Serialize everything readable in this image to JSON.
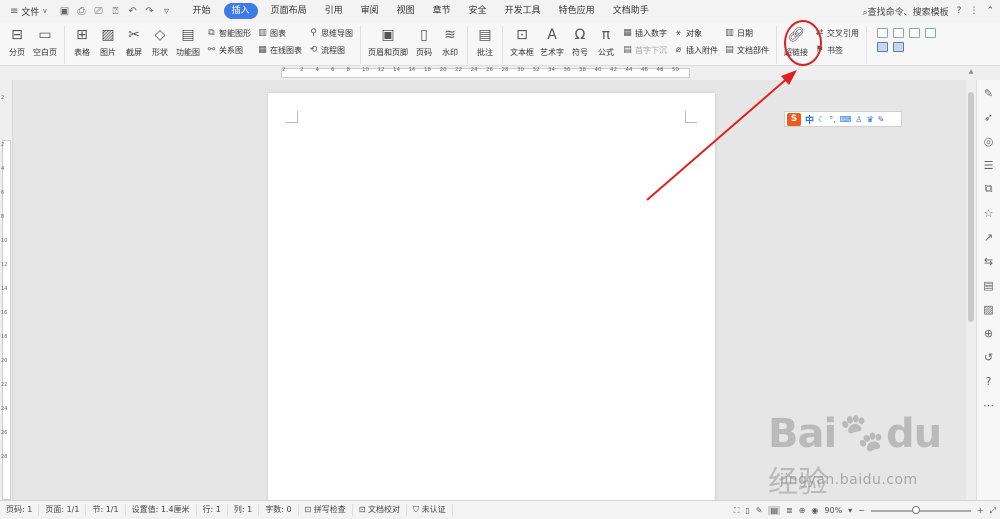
{
  "menubar": {
    "file_label": "文件",
    "tabs": [
      {
        "label": "开始",
        "active": false
      },
      {
        "label": "插入",
        "active": true
      },
      {
        "label": "页面布局",
        "active": false
      },
      {
        "label": "引用",
        "active": false
      },
      {
        "label": "审阅",
        "active": false
      },
      {
        "label": "视图",
        "active": false
      },
      {
        "label": "章节",
        "active": false
      },
      {
        "label": "安全",
        "active": false
      },
      {
        "label": "开发工具",
        "active": false
      },
      {
        "label": "特色应用",
        "active": false
      },
      {
        "label": "文档助手",
        "active": false
      }
    ],
    "search_label": "查找命令、搜索模板",
    "help_label": "?",
    "more_label": "⋮"
  },
  "ribbon": {
    "page_break": "分页",
    "blank_page": "空白页",
    "table": "表格",
    "picture": "图片",
    "screenshot": "截屏",
    "shape": "形状",
    "function_chart": "功能图",
    "smart_art": "智能图形",
    "relation_chart": "关系图",
    "chart": "图表",
    "online_chart": "在线图表",
    "mind_map": "思维导图",
    "flow_chart": "流程图",
    "header_footer": "页眉和页脚",
    "page_number": "页码",
    "watermark": "水印",
    "comment": "批注",
    "textbox": "文本框",
    "wordart": "艺术字",
    "symbol": "符号",
    "formula": "公式",
    "insert_number": "插入数字",
    "object": "对象",
    "date": "日期",
    "first_letter_sink": "首字下沉",
    "insert_attachment": "插入附件",
    "document_parts": "文档部件",
    "hyperlink": "超链接",
    "cross_reference": "交叉引用",
    "bookmark": "书签"
  },
  "ruler": {
    "h_ticks": [
      "2",
      "2",
      "4",
      "6",
      "8",
      "10",
      "12",
      "14",
      "16",
      "18",
      "20",
      "22",
      "24",
      "26",
      "28",
      "30",
      "32",
      "34",
      "36",
      "38",
      "40",
      "42",
      "44",
      "46",
      "48",
      "50"
    ],
    "v_ticks": [
      "2",
      "2",
      "4",
      "6",
      "8",
      "10",
      "12",
      "14",
      "16",
      "18",
      "20",
      "22",
      "24",
      "26",
      "28"
    ]
  },
  "ime": {
    "logo": "S",
    "lang": "中"
  },
  "watermark": {
    "brand": "Bai",
    "brand_tail": "du",
    "cn": "经验",
    "url": "jingyan.baidu.com"
  },
  "status": {
    "page_no": "页码: 1",
    "pages": "页面: 1/1",
    "section": "节: 1/1",
    "setting": "设置值: 1.4厘米",
    "row": "行: 1",
    "col": "列: 1",
    "word_count": "字数: 0",
    "spell_check": "拼写检查",
    "doc_check": "文档校对",
    "unverified": "未认证",
    "zoom": "90%",
    "zoom_level": 0.45
  },
  "colors": {
    "accent": "#3c7ce4",
    "highlight": "#e02020"
  }
}
